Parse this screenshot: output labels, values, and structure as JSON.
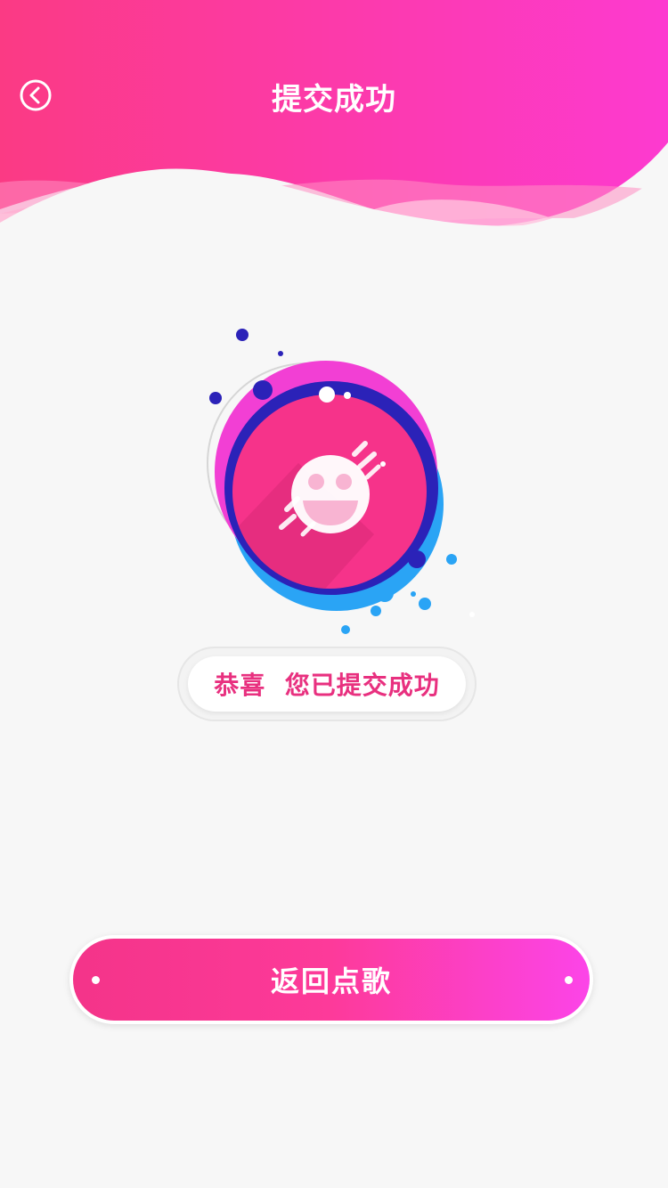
{
  "header": {
    "title": "提交成功",
    "back_icon": "chevron-left-circle-icon",
    "gradient": [
      "#fb3a84",
      "#fd3ad0"
    ]
  },
  "illustration": {
    "icon": "laughing-face-icon",
    "colors": {
      "pink": "#f6338a",
      "magenta": "#f23fd4",
      "navy": "#2b22b8",
      "blue": "#2aa4f5"
    }
  },
  "message": {
    "text": "恭喜  您已提交成功",
    "color": "#e8307f"
  },
  "action_button": {
    "label": "返回点歌"
  }
}
